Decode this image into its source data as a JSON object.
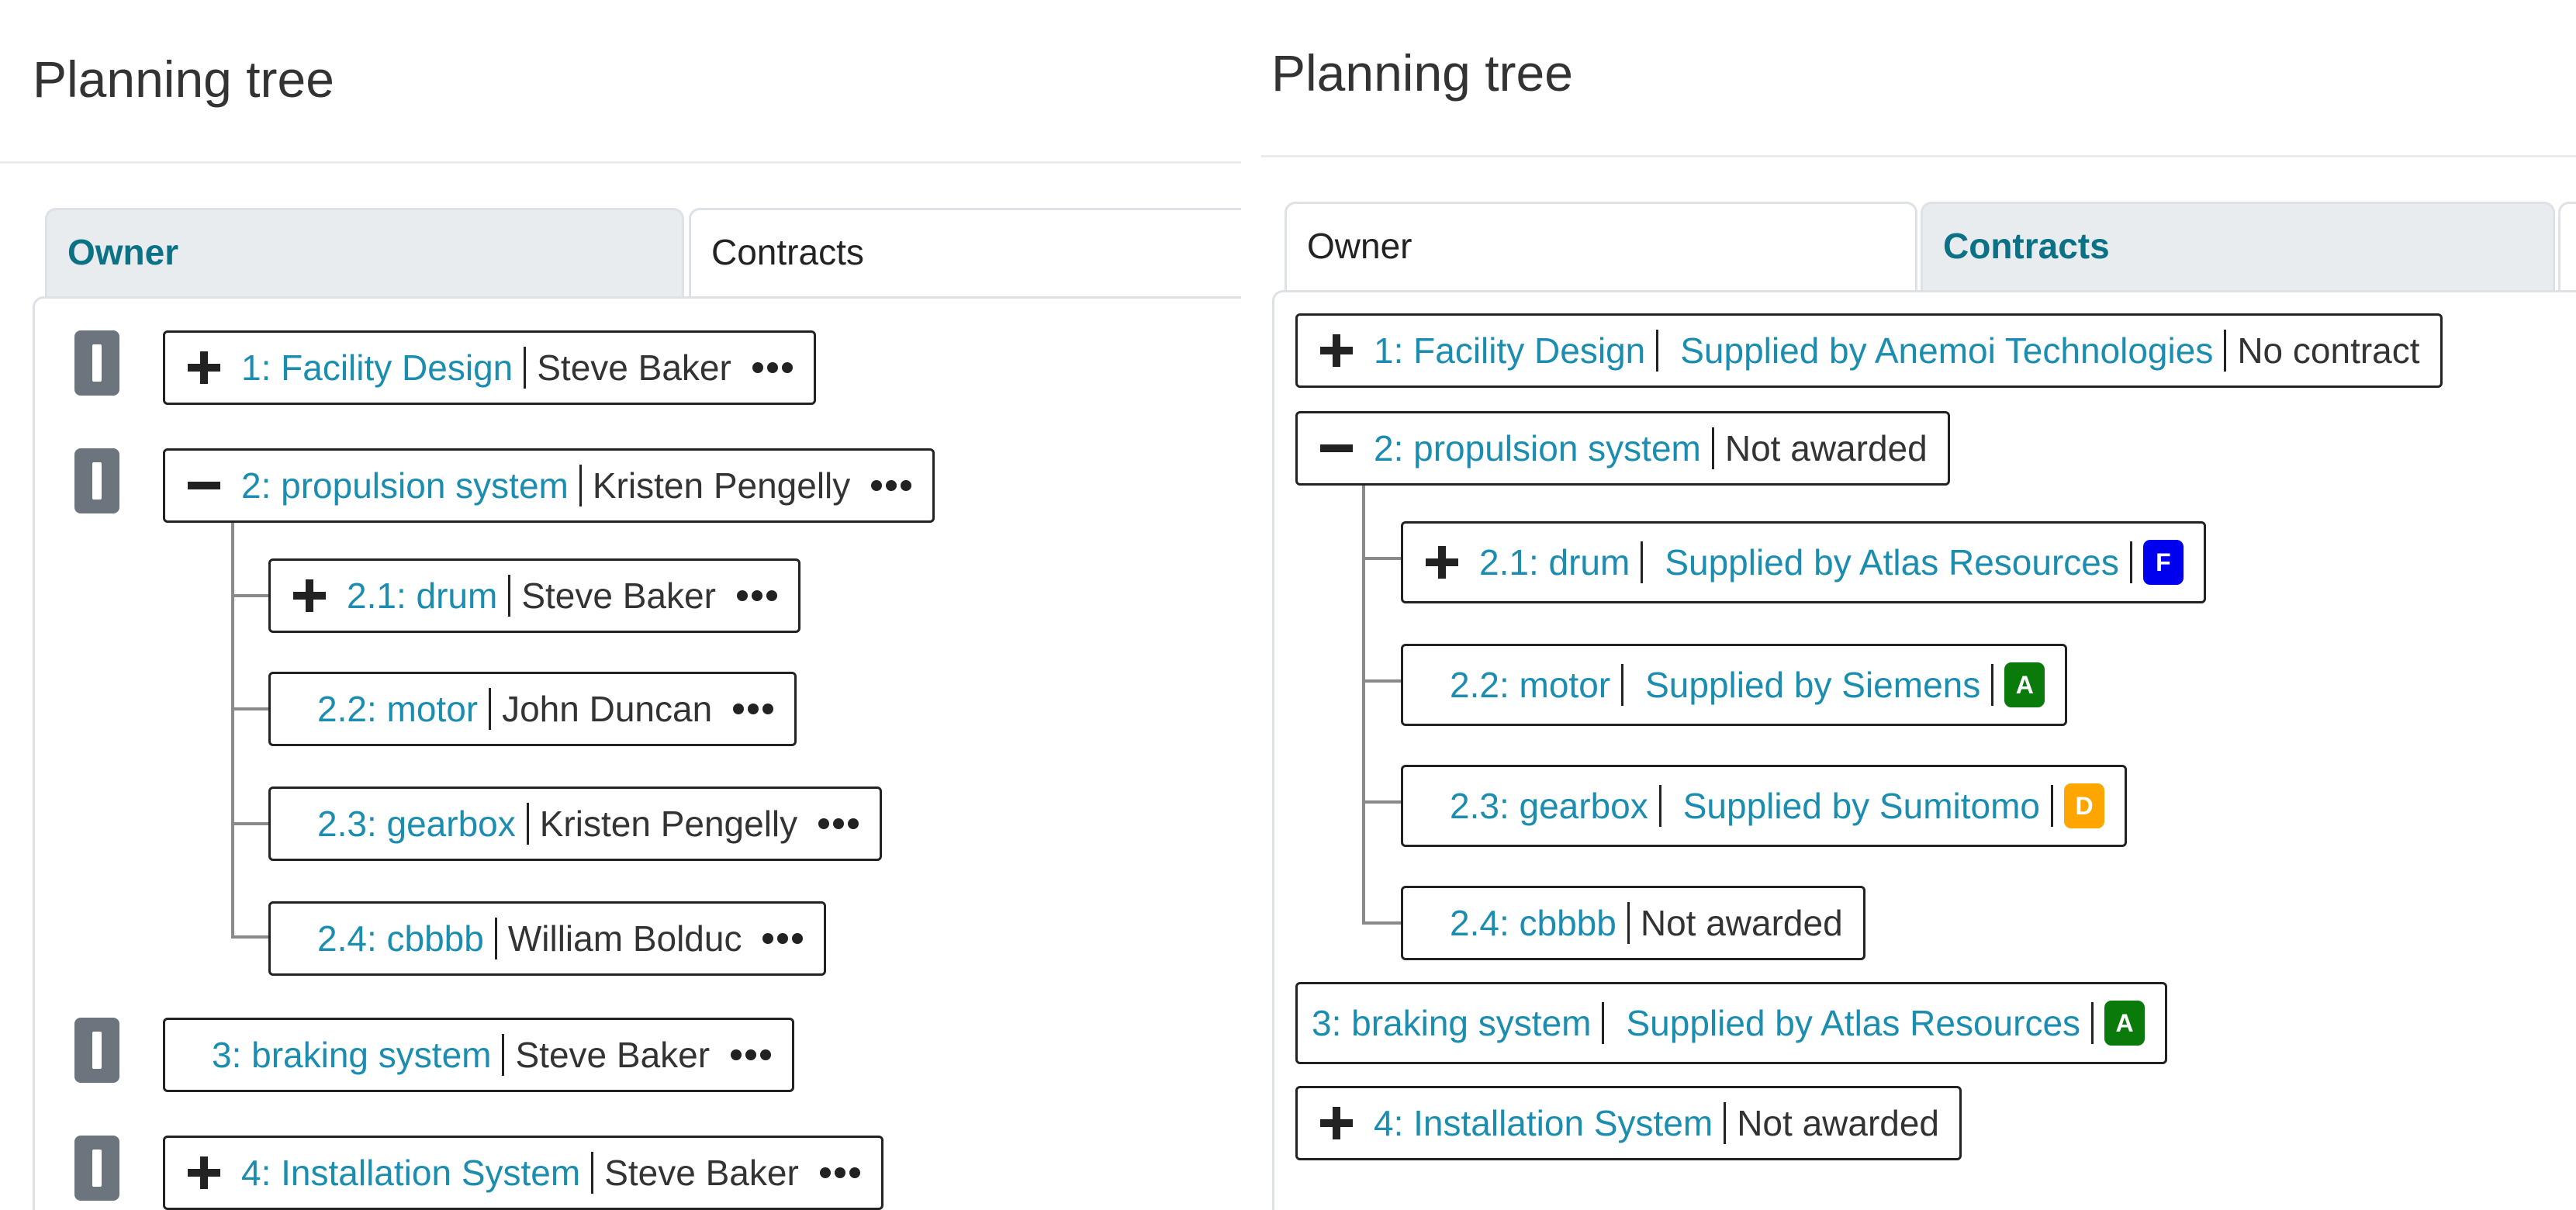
{
  "colors": {
    "link": "#1a8db0",
    "active_tab": "#0b7285",
    "badge_F": "#0000ee",
    "badge_A": "#0a7a0a",
    "badge_D": "#ffa500",
    "handle": "#6c757d"
  },
  "left": {
    "title": "Planning tree",
    "tabs": [
      "Owner",
      "Contracts"
    ],
    "nodes": [
      {
        "icon": "plus-icon",
        "label": "1: Facility Design",
        "owner": "Steve Baker"
      },
      {
        "icon": "minus-icon",
        "label": "2: propulsion system",
        "owner": "Kristen Pengelly"
      },
      {
        "icon": "plus-icon",
        "label": "2.1: drum",
        "owner": "Steve Baker"
      },
      {
        "icon": null,
        "label": "2.2: motor",
        "owner": "John Duncan"
      },
      {
        "icon": null,
        "label": "2.3: gearbox",
        "owner": "Kristen Pengelly"
      },
      {
        "icon": null,
        "label": "2.4: cbbbb",
        "owner": "William Bolduc"
      },
      {
        "icon": null,
        "label": "3: braking system",
        "owner": "Steve Baker"
      },
      {
        "icon": "plus-icon",
        "label": "4: Installation System",
        "owner": "Steve Baker"
      }
    ]
  },
  "right": {
    "title": "Planning tree",
    "tabs": [
      "Owner",
      "Contracts"
    ],
    "nodes": [
      {
        "icon": "plus-icon",
        "label": "1: Facility Design",
        "supplier": "Supplied by Anemoi Technologies",
        "status": "No contract"
      },
      {
        "icon": "minus-icon",
        "label": "2: propulsion system",
        "status": "Not awarded"
      },
      {
        "icon": "plus-icon",
        "label": "2.1: drum",
        "supplier": "Supplied by Atlas Resources",
        "badge": "F"
      },
      {
        "icon": null,
        "label": "2.2: motor",
        "supplier": "Supplied by Siemens",
        "badge": "A"
      },
      {
        "icon": null,
        "label": "2.3: gearbox",
        "supplier": "Supplied by Sumitomo",
        "badge": "D"
      },
      {
        "icon": null,
        "label": "2.4: cbbbb",
        "status": "Not awarded"
      },
      {
        "icon": null,
        "label": "3: braking system",
        "supplier": "Supplied by Atlas Resources",
        "badge": "A"
      },
      {
        "icon": "plus-icon",
        "label": "4: Installation System",
        "status": "Not awarded"
      }
    ]
  }
}
